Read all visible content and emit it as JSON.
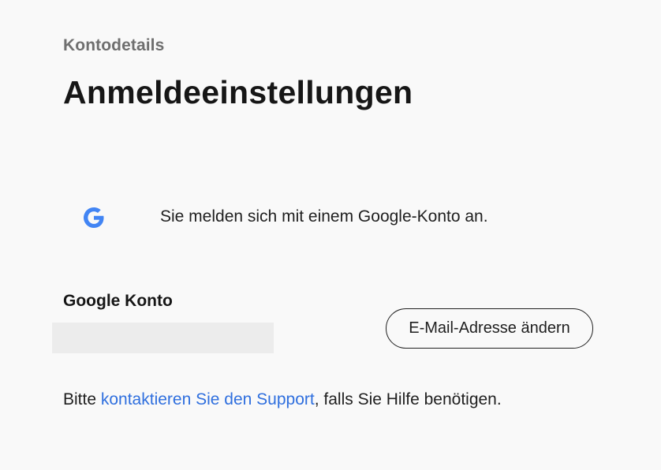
{
  "header": {
    "breadcrumb": "Kontodetails",
    "title": "Anmeldeeinstellungen"
  },
  "login_method": {
    "icon": "google-icon",
    "text": "Sie melden sich mit einem Google-Konto an."
  },
  "account": {
    "label": "Google Konto",
    "email_value": "",
    "change_button_label": "E-Mail-Adresse ändern"
  },
  "help": {
    "prefix": "Bitte ",
    "link_text": "kontaktieren Sie den Support",
    "suffix": ", falls Sie Hilfe benötigen."
  },
  "colors": {
    "background": "#f9f9f9",
    "link": "#2f6fde",
    "google_blue": "#4285f4",
    "redaction": "#ececec"
  }
}
